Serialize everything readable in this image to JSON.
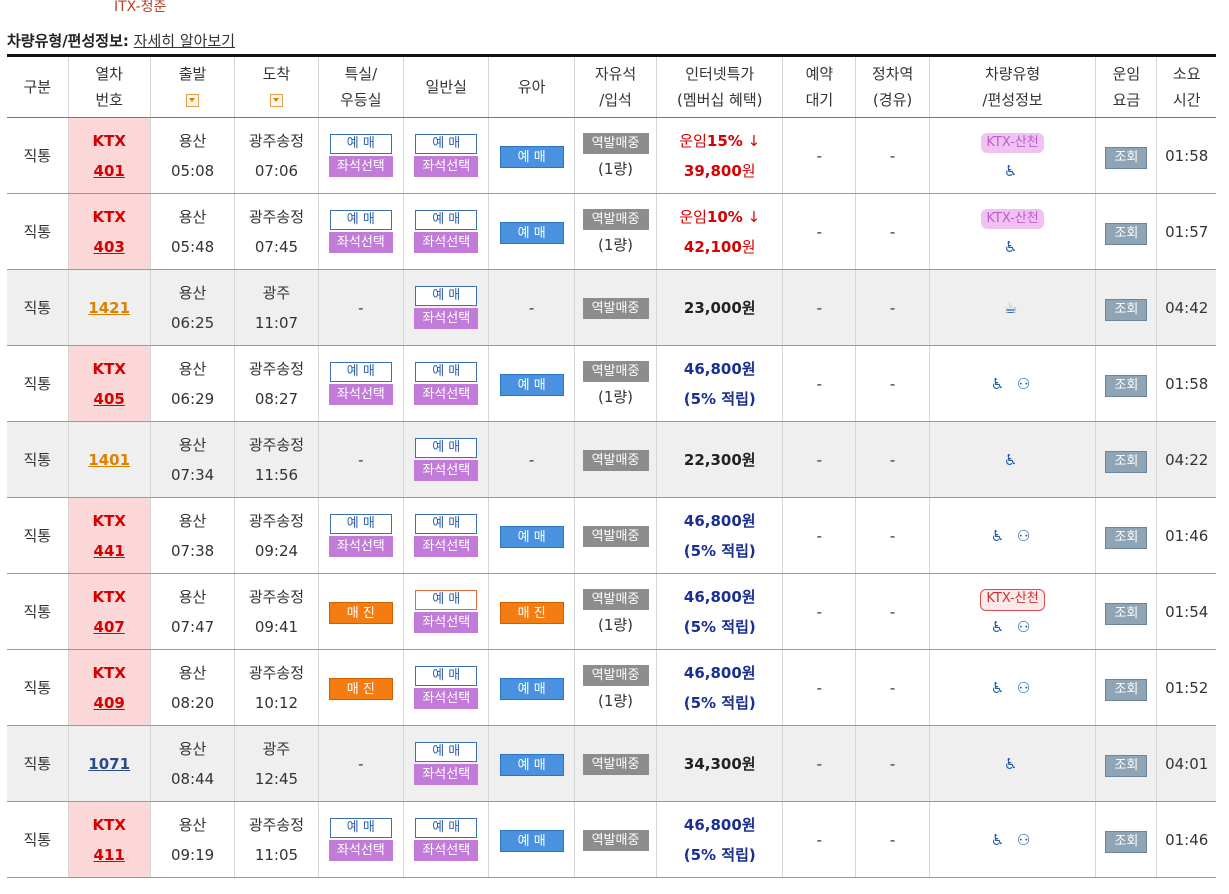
{
  "top_note": "ITX-청춘",
  "info": {
    "label": "차량유형/편성정보:",
    "link": "자세히 알아보기"
  },
  "headers": {
    "type": "구분",
    "train_no": [
      "열차",
      "번호"
    ],
    "depart": "출발",
    "arrive": "도착",
    "special": [
      "특실/",
      "우등실"
    ],
    "general": "일반실",
    "infant": "유아",
    "free_seat": [
      "자유석",
      "/입석"
    ],
    "internet": [
      "인터넷특가",
      "(멤버십 혜택)"
    ],
    "waitlist": [
      "예약",
      "대기"
    ],
    "stops": [
      "정차역",
      "(경유)"
    ],
    "vehicle": [
      "차량유형",
      "/편성정보"
    ],
    "fare": [
      "운임",
      "요금"
    ],
    "duration": [
      "소요",
      "시간"
    ]
  },
  "labels": {
    "book": "예 매",
    "seat_select": "좌석선택",
    "sold_out": "매 진",
    "station_sale": "역발매중",
    "one_car": "(1량)",
    "lookup": "조회",
    "dash": "-",
    "ktx_sancheon": "KTX-산천",
    "points": "(5% 적립)",
    "won": "원",
    "fare_discount": "운임"
  },
  "rows": [
    {
      "type": "직통",
      "train_kind": "KTX",
      "train_no": "401",
      "from": "용산",
      "dep": "05:08",
      "to": "광주송정",
      "arr": "07:06",
      "special": "book",
      "general": "book",
      "infant": "blue",
      "free": "1량",
      "fare_mode": "discount",
      "pct": "15%",
      "fare": "39,800",
      "waitlist": "-",
      "stops": "-",
      "vehicle": "sancheon-light",
      "duration": "01:58",
      "color": "#d50000"
    },
    {
      "type": "직통",
      "train_kind": "KTX",
      "train_no": "403",
      "from": "용산",
      "dep": "05:48",
      "to": "광주송정",
      "arr": "07:45",
      "special": "book",
      "general": "book",
      "infant": "blue",
      "free": "1량",
      "fare_mode": "discount",
      "pct": "10%",
      "fare": "42,100",
      "waitlist": "-",
      "stops": "-",
      "vehicle": "sancheon-light",
      "duration": "01:57",
      "color": "#d50000"
    },
    {
      "type": "직통",
      "train_kind": "",
      "train_no": "1421",
      "from": "용산",
      "dep": "06:25",
      "to": "광주",
      "arr": "11:07",
      "special": "dash",
      "general": "book",
      "infant": "dash",
      "free": "none",
      "fare_mode": "plain",
      "fare": "23,000",
      "waitlist": "-",
      "stops": "-",
      "vehicle": "cafe",
      "duration": "04:42",
      "color": "#e08000"
    },
    {
      "type": "직통",
      "train_kind": "KTX",
      "train_no": "405",
      "from": "용산",
      "dep": "06:29",
      "to": "광주송정",
      "arr": "08:27",
      "special": "book",
      "general": "book",
      "infant": "blue",
      "free": "1량",
      "fare_mode": "points",
      "fare": "46,800",
      "waitlist": "-",
      "stops": "-",
      "vehicle": "wheel-family",
      "duration": "01:58",
      "color": "#d50000"
    },
    {
      "type": "직통",
      "train_kind": "",
      "train_no": "1401",
      "from": "용산",
      "dep": "07:34",
      "to": "광주송정",
      "arr": "11:56",
      "special": "dash",
      "general": "book",
      "infant": "dash",
      "free": "none",
      "fare_mode": "plain",
      "fare": "22,300",
      "waitlist": "-",
      "stops": "-",
      "vehicle": "wheel",
      "duration": "04:22",
      "color": "#e08000"
    },
    {
      "type": "직통",
      "train_kind": "KTX",
      "train_no": "441",
      "from": "용산",
      "dep": "07:38",
      "to": "광주송정",
      "arr": "09:24",
      "special": "book",
      "general": "book",
      "infant": "blue",
      "free": "none",
      "fare_mode": "points",
      "fare": "46,800",
      "waitlist": "-",
      "stops": "-",
      "vehicle": "wheel-family",
      "duration": "01:46",
      "color": "#d50000"
    },
    {
      "type": "직통",
      "train_kind": "KTX",
      "train_no": "407",
      "from": "용산",
      "dep": "07:47",
      "to": "광주송정",
      "arr": "09:41",
      "special": "soldout",
      "general": "book-red",
      "infant": "soldout",
      "free": "1량",
      "fare_mode": "points",
      "fare": "46,800",
      "waitlist": "-",
      "stops": "-",
      "vehicle": "sancheon-outline",
      "duration": "01:54",
      "color": "#d50000"
    },
    {
      "type": "직통",
      "train_kind": "KTX",
      "train_no": "409",
      "from": "용산",
      "dep": "08:20",
      "to": "광주송정",
      "arr": "10:12",
      "special": "soldout",
      "general": "book",
      "infant": "blue",
      "free": "1량",
      "fare_mode": "points",
      "fare": "46,800",
      "waitlist": "-",
      "stops": "-",
      "vehicle": "wheel-family",
      "duration": "01:52",
      "color": "#d50000"
    },
    {
      "type": "직통",
      "train_kind": "",
      "train_no": "1071",
      "from": "용산",
      "dep": "08:44",
      "to": "광주",
      "arr": "12:45",
      "special": "dash",
      "general": "book",
      "infant": "blue",
      "free": "none",
      "fare_mode": "plain",
      "fare": "34,300",
      "waitlist": "-",
      "stops": "-",
      "vehicle": "wheel",
      "duration": "04:01",
      "color": "#2b4b86"
    },
    {
      "type": "직통",
      "train_kind": "KTX",
      "train_no": "411",
      "from": "용산",
      "dep": "09:19",
      "to": "광주송정",
      "arr": "11:05",
      "special": "book",
      "general": "book",
      "infant": "blue",
      "free": "none",
      "fare_mode": "points",
      "fare": "46,800",
      "waitlist": "-",
      "stops": "-",
      "vehicle": "wheel-family",
      "duration": "01:46",
      "color": "#d50000"
    }
  ]
}
